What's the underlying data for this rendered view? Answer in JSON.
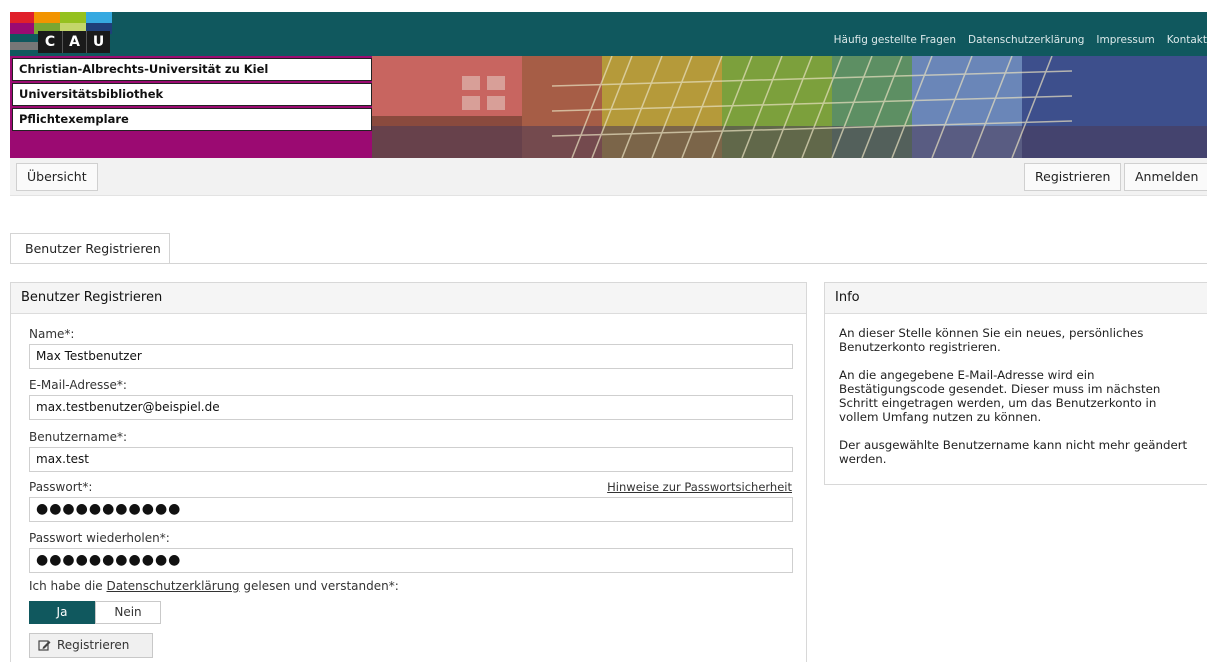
{
  "header": {
    "logo_letters": [
      "C",
      "A",
      "U"
    ],
    "logo_colors": [
      "#e0202a",
      "#f29400",
      "#36a9e1",
      "#95c11f",
      "#9b0a72",
      "#777777"
    ],
    "links": [
      "Häufig gestellte Fragen",
      "Datenschutzerklärung",
      "Impressum",
      "Kontakt"
    ]
  },
  "breadcrumbs": [
    "Christian-Albrechts-Universität zu Kiel",
    "Universitätsbibliothek",
    "Pflichtexemplare"
  ],
  "nav": {
    "overview": "Übersicht",
    "register": "Registrieren",
    "login": "Anmelden"
  },
  "tab": {
    "label": "Benutzer Registrieren"
  },
  "form": {
    "title": "Benutzer Registrieren",
    "name_label": "Name*:",
    "name_value": "Max Testbenutzer",
    "email_label": "E-Mail-Adresse*:",
    "email_value": "max.testbenutzer@beispiel.de",
    "username_label": "Benutzername*:",
    "username_value": "max.test",
    "password_label": "Passwort*:",
    "password_hint": "Hinweise zur Passwortsicherheit",
    "password_value": "●●●●●●●●●●●",
    "password2_label": "Passwort wiederholen*:",
    "password2_value": "●●●●●●●●●●●",
    "consent_prefix": "Ich habe die ",
    "consent_link": "Datenschutzerklärung",
    "consent_suffix": " gelesen und verstanden*:",
    "yes": "Ja",
    "no": "Nein",
    "submit": "Registrieren"
  },
  "info": {
    "title": "Info",
    "paragraphs": [
      "An dieser Stelle können Sie ein neues, persönliches Benutzerkonto registrieren.",
      "An die angegebene E-Mail-Adresse wird ein Bestätigungscode gesendet. Dieser muss im nächsten Schritt eingetragen werden, um das Benutzerkonto in vollem Umfang nutzen zu können.",
      "Der ausgewählte Benutzername kann nicht mehr geändert werden."
    ]
  },
  "colors": {
    "brand_teal": "#10585e",
    "banner_magenta": "#9b0a72"
  }
}
